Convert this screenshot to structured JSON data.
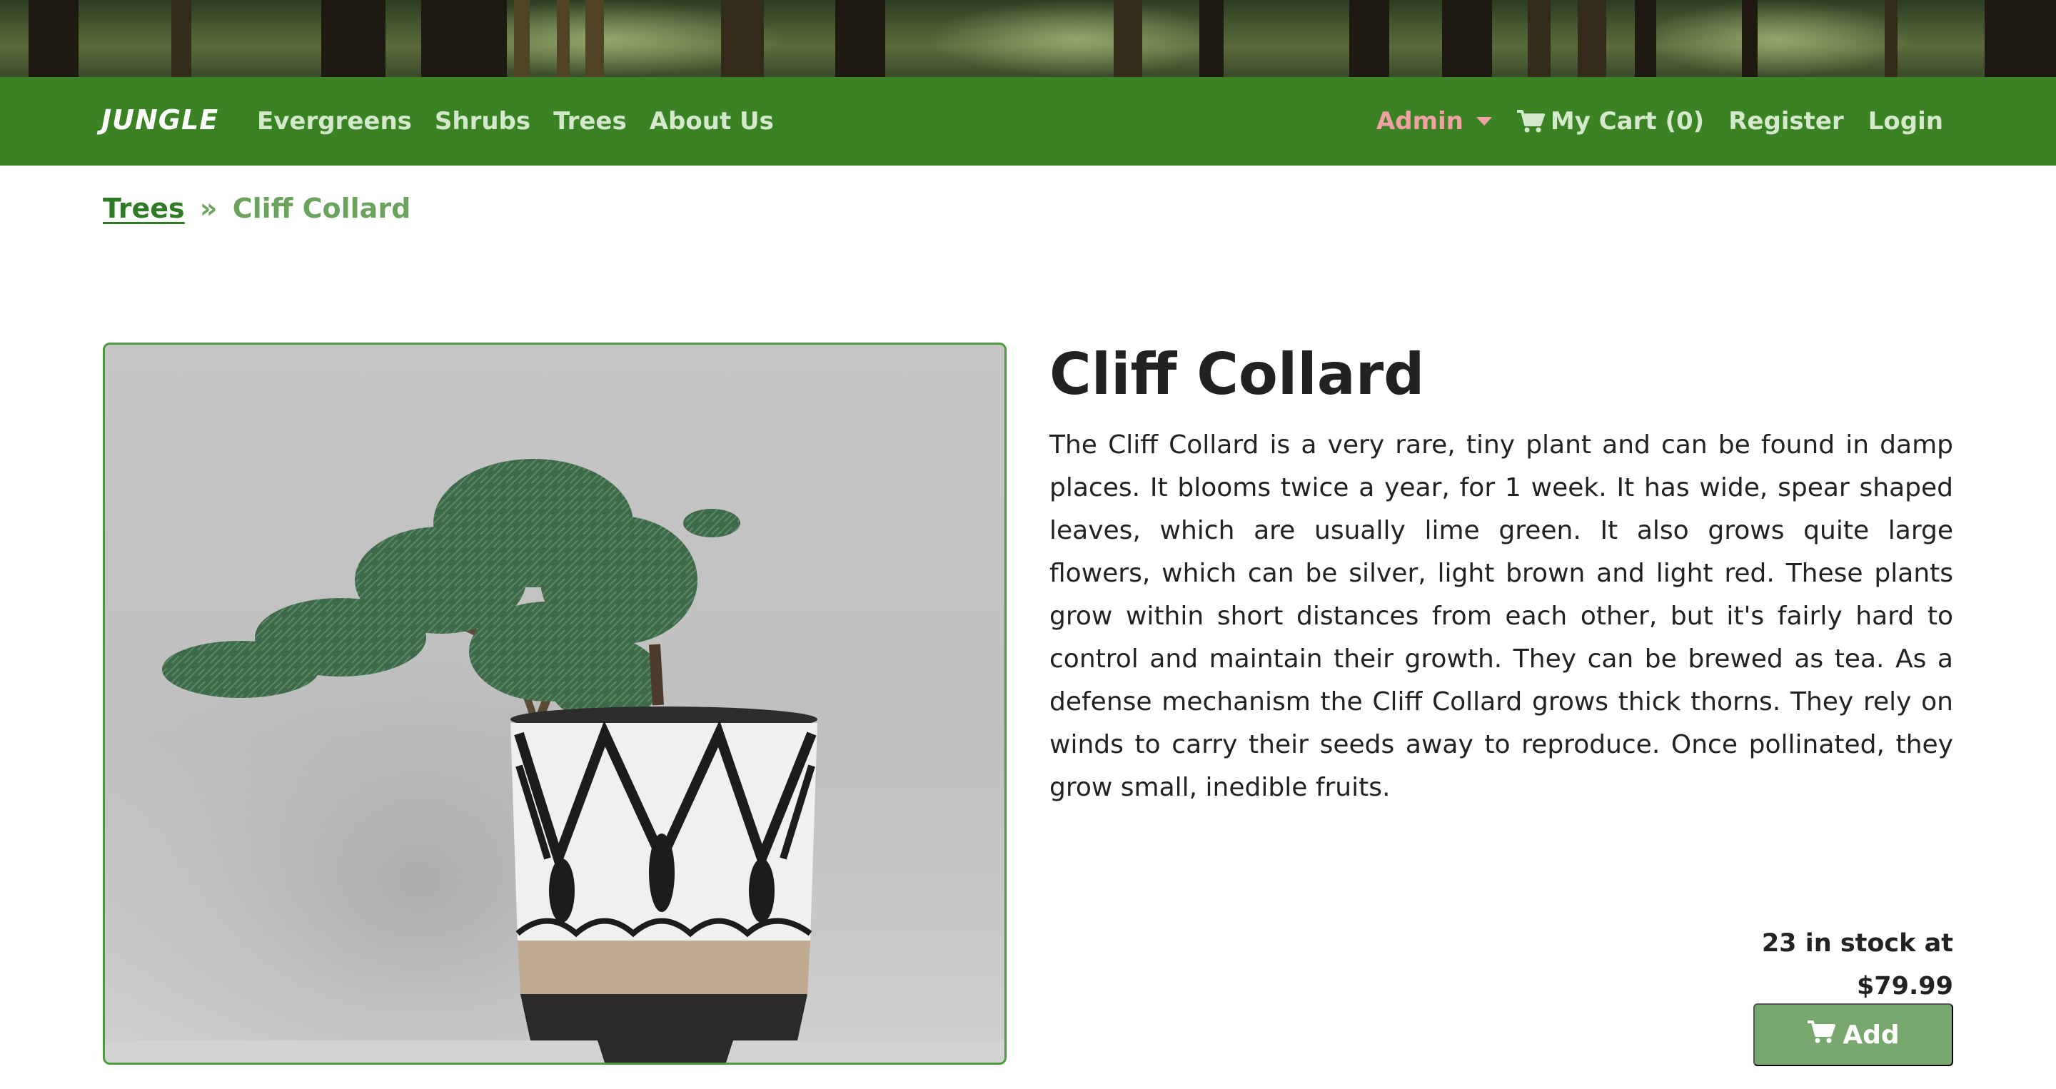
{
  "navbar": {
    "brand": "JUNGLE",
    "links": [
      "Evergreens",
      "Shrubs",
      "Trees",
      "About Us"
    ],
    "admin_label": "Admin",
    "cart_label": "My Cart (0)",
    "register_label": "Register",
    "login_label": "Login",
    "colors": {
      "background": "#3a8224",
      "link": "#d4e8cb",
      "admin": "#f1a1a1"
    }
  },
  "breadcrumb": {
    "parent": "Trees",
    "separator": "»",
    "current": "Cliff Collard"
  },
  "product": {
    "name": "Cliff Collard",
    "description": "The Cliff Collard is a very rare, tiny plant and can be found in damp places. It blooms twice a year, for 1 week. It has wide, spear shaped leaves, which are usually lime green. It also grows quite large flowers, which can be silver, light brown and light red. These plants grow within short distances from each other, but it's fairly hard to control and maintain their growth. They can be brewed as tea. As a defense mechanism the Cliff Collard grows thick thorns. They rely on winds to carry their seeds away to reproduce. Once pollinated, they grow small, inedible fruits.",
    "stock_line": "23 in stock at",
    "price": "$79.99",
    "add_label": "Add",
    "image_icon": "bonsai-in-patterned-pot"
  },
  "icons": {
    "cart": "cart-icon",
    "caret": "caret-down-icon"
  }
}
